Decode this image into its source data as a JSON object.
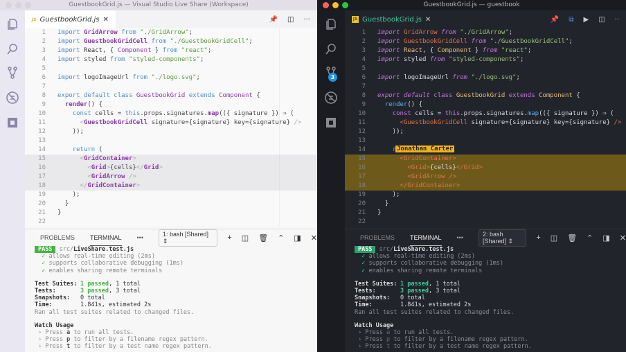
{
  "left_window": {
    "title": "GuestbookGrid.js — Visual Studio Live Share (Workspace)",
    "tab": {
      "icon": "JS",
      "label": "GuestbookGrid.js"
    },
    "toolbar_icons": [
      "pin-icon",
      "split-editor-icon",
      "more-icon"
    ],
    "activity_icons": [
      "files-icon",
      "search-icon",
      "source-control-icon",
      "debug-icon",
      "extensions-icon"
    ],
    "panel": {
      "tabs": [
        "PROBLEMS",
        "TERMINAL"
      ],
      "active_tab": "TERMINAL",
      "more": "•••",
      "terminal_select": "1: bash [Shared]",
      "icons": [
        "plus-icon",
        "split-terminal-icon",
        "trash-icon",
        "maximize-panel-icon",
        "panel-toggle-icon",
        "close-icon"
      ]
    }
  },
  "right_window": {
    "title": "GuestbookGrid.js — guestbook",
    "tab": {
      "icon": "JS",
      "label": "GuestbookGrid.js"
    },
    "toolbar_icons": [
      "pin-icon",
      "live-share-icon",
      "run-icon",
      "split-editor-icon",
      "more-icon"
    ],
    "activity_icons": [
      "files-icon",
      "search-icon",
      "source-control-icon",
      "debug-icon",
      "extensions-icon"
    ],
    "source_control_badge": "3",
    "collaborator_flag": "Jonathan Carter",
    "panel": {
      "tabs": [
        "PROBLEMS",
        "TERMINAL"
      ],
      "active_tab": "TERMINAL",
      "more": "•••",
      "terminal_select": "2: bash [Shared]",
      "icons": [
        "plus-icon",
        "split-terminal-icon",
        "trash-icon",
        "maximize-panel-icon",
        "panel-toggle-icon",
        "close-icon"
      ]
    }
  },
  "code_lines": [
    "import GridArrow from \"./GridArrow\";",
    "import GuestbookGridCell from \"./GuestbookGridCell\";",
    "import React, { Component } from \"react\";",
    "import styled from \"styled-components\";",
    "",
    "import logoImageUrl from \"./logo.svg\";",
    "",
    "export default class GuestbookGrid extends Component {",
    "  render() {",
    "    const cells = this.props.signatures.map(({ signature }) ⇒ (",
    "      <GuestbookGridCell signature={signature} key={signature} />",
    "    ));",
    "",
    "    return (",
    "      <GridContainer>",
    "        <Grid>{cells}</Grid>",
    "        <GridArrow />",
    "      </GridContainer>",
    "    );",
    "  }",
    "}",
    ""
  ],
  "terminal": {
    "pass_badge": "PASS",
    "file_prefix": "src/",
    "file_name": "LiveShare.test.js",
    "tests": [
      "allows real-time editing (2ms)",
      "supports collaborative debugging (1ms)",
      "enables sharing remote terminals"
    ],
    "check": "✓",
    "summary": [
      {
        "label": "Test Suites:",
        "passed": "1 passed",
        "rest": ", 1 total"
      },
      {
        "label": "Tests:",
        "passed": "3 passed",
        "rest": ", 3 total"
      },
      {
        "label": "Snapshots:",
        "passed": "",
        "rest": "0 total"
      },
      {
        "label": "Time:",
        "passed": "",
        "rest": "1.841s, estimated 2s"
      }
    ],
    "ran_all": "Ran all test suites related to changed files.",
    "watch_title": "Watch Usage",
    "watch": [
      {
        "pre": "› Press ",
        "key": "a",
        "post": " to run all tests."
      },
      {
        "pre": "› Press ",
        "key": "p",
        "post": " to filter by a filename regex pattern."
      },
      {
        "pre": "› Press ",
        "key": "t",
        "post": " to filter by a test name regex pattern."
      }
    ]
  },
  "colors": {
    "light_keyword": "#4a8bc2",
    "light_string": "#5b9a3a",
    "light_tag": "#8a3aa8",
    "dark_keyword": "#c678dd",
    "dark_string": "#98c379",
    "dark_tag": "#e0754a",
    "dark_ident": "#e5c07b",
    "pass_green": "#3fb73f",
    "collab_flag": "#f0b41a"
  }
}
